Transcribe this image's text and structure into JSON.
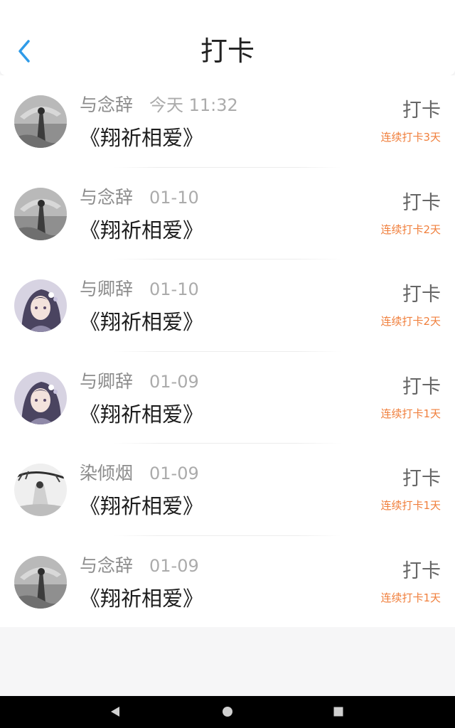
{
  "header": {
    "title": "打卡",
    "back_icon": "chevron-left-icon"
  },
  "colors": {
    "accent": "#2f9be8",
    "streak": "#f07f3c",
    "title": "#222222",
    "name": "#8c8c8c",
    "time": "#ababab"
  },
  "checkins": [
    {
      "name": "与念辞",
      "time": "今天 11:32",
      "book": "《翔祈相爱》",
      "action": "打卡",
      "streak": "连续打卡3天",
      "avatar": "avatar-umbrella-girl"
    },
    {
      "name": "与念辞",
      "time": "01-10",
      "book": "《翔祈相爱》",
      "action": "打卡",
      "streak": "连续打卡2天",
      "avatar": "avatar-umbrella-girl"
    },
    {
      "name": "与卿辞",
      "time": "01-10",
      "book": "《翔祈相爱》",
      "action": "打卡",
      "streak": "连续打卡2天",
      "avatar": "avatar-anime-girl"
    },
    {
      "name": "与卿辞",
      "time": "01-09",
      "book": "《翔祈相爱》",
      "action": "打卡",
      "streak": "连续打卡1天",
      "avatar": "avatar-anime-girl"
    },
    {
      "name": "染倾烟",
      "time": "01-09",
      "book": "《翔祈相爱》",
      "action": "打卡",
      "streak": "连续打卡1天",
      "avatar": "avatar-ink-painting"
    },
    {
      "name": "与念辞",
      "time": "01-09",
      "book": "《翔祈相爱》",
      "action": "打卡",
      "streak": "连续打卡1天",
      "avatar": "avatar-umbrella-girl"
    }
  ],
  "system_nav": {
    "back_icon": "triangle-back-icon",
    "home_icon": "circle-home-icon",
    "recent_icon": "square-recent-icon"
  }
}
